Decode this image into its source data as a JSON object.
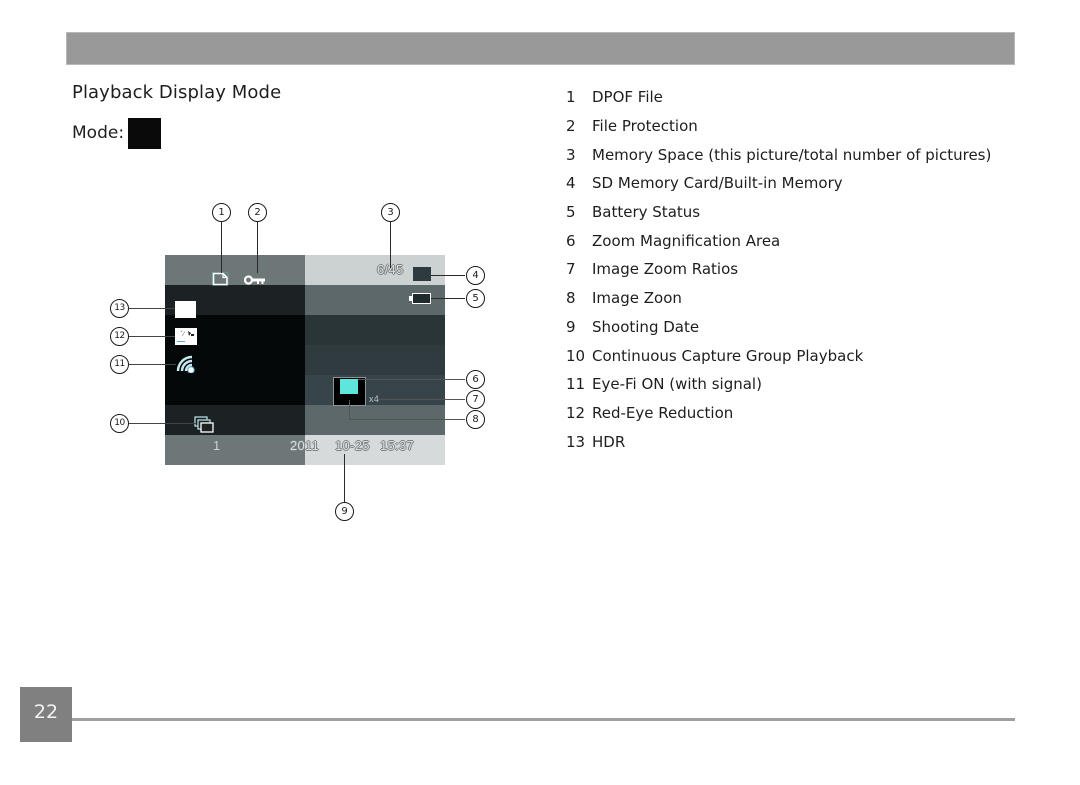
{
  "header": {
    "bar_color": "#999999"
  },
  "section": {
    "title": "Playback Display Mode",
    "mode_label": "Mode:"
  },
  "screen": {
    "memory_space": "6/45",
    "zoom_ratio": "x4",
    "group_index": "1",
    "date_year": "2011",
    "date_md": "10-25",
    "time": "15:37",
    "zoom_area_color": "#5ee6dc",
    "callouts": [
      "1",
      "2",
      "3",
      "4",
      "5",
      "6",
      "7",
      "8",
      "9",
      "10",
      "11",
      "12",
      "13"
    ]
  },
  "legend": {
    "items": [
      {
        "num": "1",
        "label": "DPOF File"
      },
      {
        "num": "2",
        "label": "File Protection"
      },
      {
        "num": "3",
        "label": "Memory Space (this picture/total number of pictures)"
      },
      {
        "num": "4",
        "label": "SD Memory Card/Built-in Memory"
      },
      {
        "num": "5",
        "label": "Battery Status"
      },
      {
        "num": "6",
        "label": "Zoom Magnification Area"
      },
      {
        "num": "7",
        "label": "Image Zoom Ratios"
      },
      {
        "num": "8",
        "label": "Image Zoon"
      },
      {
        "num": "9",
        "label": "Shooting Date"
      },
      {
        "num": "10",
        "label": "Continuous Capture Group Playback"
      },
      {
        "num": "11",
        "label": "Eye-Fi ON (with signal)"
      },
      {
        "num": "12",
        "label": "Red-Eye Reduction"
      },
      {
        "num": "13",
        "label": "HDR"
      }
    ]
  },
  "footer": {
    "page_number": "22"
  }
}
